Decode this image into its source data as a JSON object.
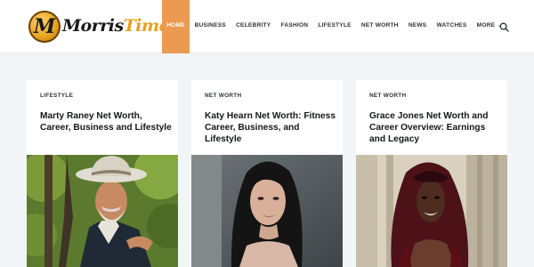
{
  "site": {
    "logo_letter": "M",
    "logo_part1": "Morris",
    "logo_part2": "Time",
    "brand_color": "#e6a21e",
    "accent_color": "#eb9a52"
  },
  "nav": {
    "items": [
      "HOME",
      "BUSINESS",
      "CELEBRITY",
      "FASHION",
      "LIFESTYLE",
      "NET WORTH",
      "NEWS",
      "WATCHES"
    ],
    "more_label": "MORE",
    "more_icon": "chevron-down-icon",
    "search_icon": "search-icon"
  },
  "articles": [
    {
      "category": "LIFESTYLE",
      "title": "Marty Raney Net Worth, Career, Business and Lifestyle",
      "image": "man-in-cowboy-hat-photo"
    },
    {
      "category": "NET WORTH",
      "title": "Katy Hearn Net Worth: Fitness Career, Business, and Lifestyle",
      "image": "woman-with-long-dark-hair-photo"
    },
    {
      "category": "NET WORTH",
      "title": "Grace Jones Net Worth and Career Overview: Earnings and Legacy",
      "image": "woman-with-head-scarf-photo"
    }
  ]
}
